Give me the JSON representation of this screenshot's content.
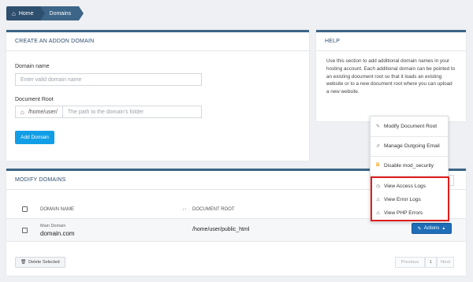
{
  "breadcrumb": {
    "home": "Home",
    "current": "Domains"
  },
  "addon": {
    "title": "CREATE AN ADDON DOMAIN",
    "domain_name_label": "Domain name",
    "domain_name_placeholder": "Enter valid domain name",
    "doc_root_label": "Document Root",
    "doc_root_prefix": "/home/user/",
    "doc_root_placeholder": "The path to the domain's folder",
    "add_button": "Add Domain"
  },
  "help": {
    "title": "HELP",
    "text": "Use this section to add additional domain names in your hosting account. Each additional domain can be pointed to an existing document root so that it loads an existing website or to a new document root where you can upload a new website."
  },
  "modify": {
    "title": "MODIFY DOMAINS",
    "columns": [
      "DOMAIN NAME",
      "DOCUMENT ROOT"
    ],
    "sort_glyph": "↓↑",
    "row": {
      "sub_label": "Main Domain",
      "domain": "domain.com",
      "doc_root": "/home/user/public_html",
      "actions_label": "Actions"
    },
    "delete_selected": "Delete Selected",
    "pagination": {
      "previous": "Previous",
      "page": "1",
      "next": "Next"
    }
  },
  "actions_menu": {
    "items": [
      {
        "label": "Modify Document Root",
        "icon": "edit-icon"
      },
      {
        "label": "Manage Outgoing Email",
        "icon": "external-link-icon"
      },
      {
        "label": "Disable mod_security",
        "icon": "bitcoin-shield-icon"
      },
      {
        "label": "View Access Logs",
        "icon": "clock-icon"
      },
      {
        "label": "View Error Logs",
        "icon": "warning-icon"
      },
      {
        "label": "View PHP Errors",
        "icon": "warning-icon"
      }
    ]
  },
  "colors": {
    "header_blue": "#3c6587",
    "primary_button": "#129ee6",
    "actions_button": "#1e6eb8",
    "highlight_red": "#e01b1b"
  }
}
